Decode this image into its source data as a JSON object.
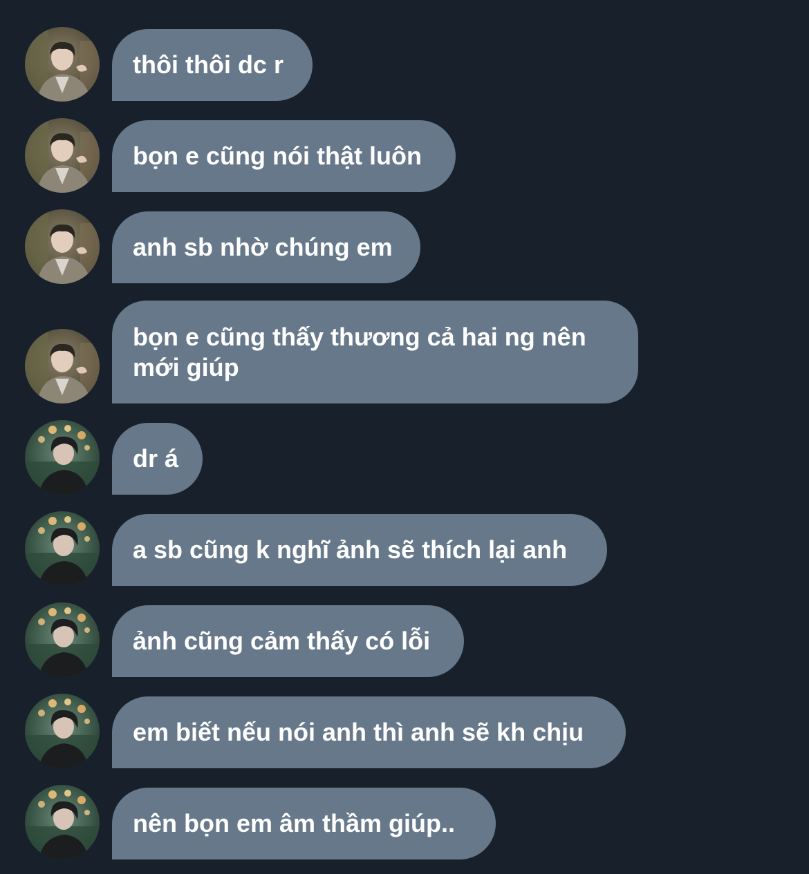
{
  "messages": [
    {
      "sender": "user-a",
      "text": "thôi thôi dc r"
    },
    {
      "sender": "user-a",
      "text": "bọn e cũng nói thật luôn"
    },
    {
      "sender": "user-a",
      "text": "anh sb nhờ chúng em"
    },
    {
      "sender": "user-a",
      "text": "bọn e cũng thấy thương cả hai ng nên mới giúp"
    },
    {
      "sender": "user-b",
      "text": "dr á"
    },
    {
      "sender": "user-b",
      "text": "a sb cũng k nghĩ ảnh sẽ thích lại anh"
    },
    {
      "sender": "user-b",
      "text": "ảnh cũng cảm thấy có lỗi"
    },
    {
      "sender": "user-b",
      "text": "em biết nếu nói anh thì anh sẽ kh chịu"
    },
    {
      "sender": "user-b",
      "text": "nên bọn em âm thầm giúp.."
    }
  ],
  "colors": {
    "background": "#18202b",
    "bubble": "#66788a",
    "text": "#ffffff"
  }
}
